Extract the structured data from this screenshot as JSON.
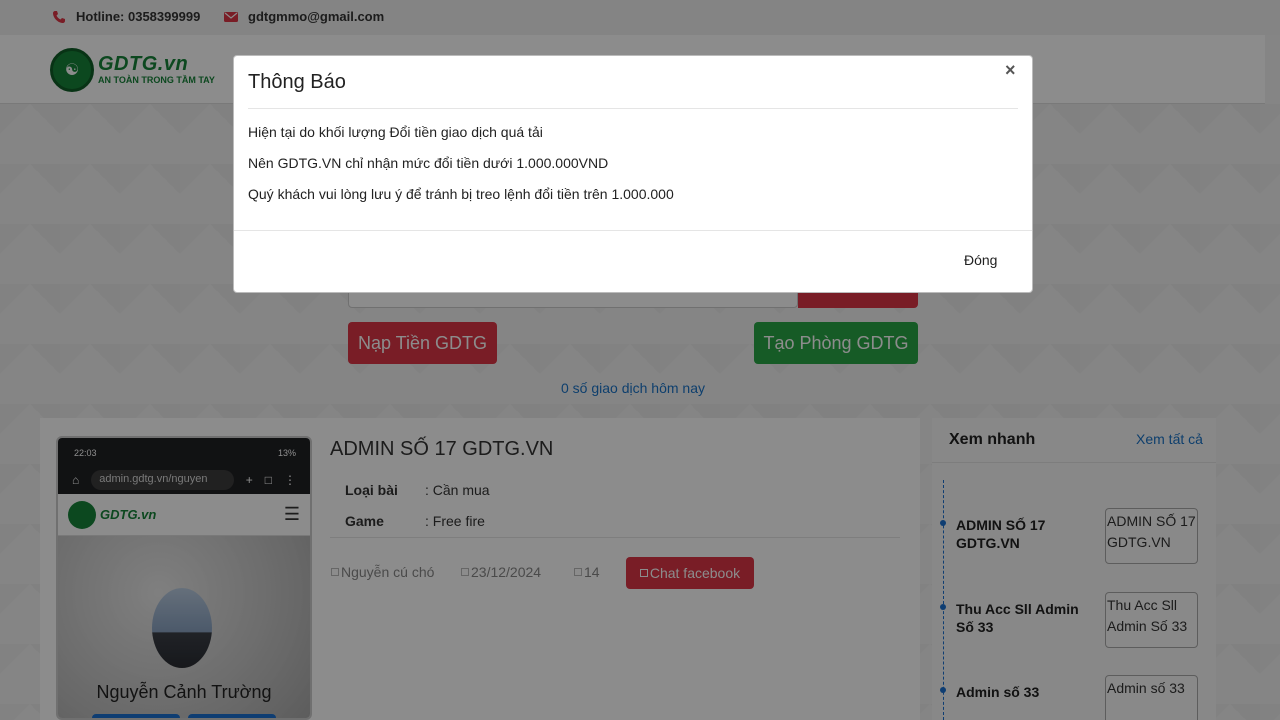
{
  "topbar": {
    "hotline": "Hotline: 0358399999",
    "email": "gdtgmmo@gmail.com"
  },
  "logo": {
    "brand": "GDTG.vn",
    "slogan": "AN TOÀN TRONG TẦM TAY"
  },
  "hero": {
    "deposit_button": "Nạp Tiền GDTG",
    "create_room_button": "Tạo Phòng GDTG",
    "today_count": "0 số giao dịch hôm nay"
  },
  "post": {
    "title": "ADMIN SỐ 17 GDTG.VN",
    "type_label": "Loại bài",
    "type_value": ":  Cần mua",
    "game_label": "Game",
    "game_value": ":  Free fire",
    "author": "Nguyễn cú chó",
    "date": "23/12/2024",
    "views": "14",
    "chat_button": "Chat facebook"
  },
  "phone_preview": {
    "time": "22:03",
    "battery": "13%",
    "url": "admin.gdtg.vn/nguyen",
    "brand": "GDTG.vn",
    "profile_name": "Nguyễn Cảnh Trường"
  },
  "sidebar": {
    "heading": "Xem nhanh",
    "view_all": "Xem tất cả",
    "items": [
      {
        "title": "ADMIN SỐ 17 GDTG.VN",
        "img_alt": "ADMIN SỐ 17 GDTG.VN"
      },
      {
        "title": "Thu Acc Sll Admin Số 33",
        "img_alt": "Thu Acc Sll Admin Số 33"
      },
      {
        "title": "Admin số 33",
        "img_alt": "Admin số 33"
      }
    ]
  },
  "modal": {
    "title": "Thông Báo",
    "close_symbol": "×",
    "lines": [
      "Hiện tại do khối lượng Đổi tiền giao dịch quá tải",
      "Nên GDTG.VN chỉ nhận mức đổi tiền dưới 1.000.000VND",
      "Quý khách vui lòng lưu ý để tránh bị treo lệnh đổi tiền trên 1.000.000"
    ],
    "close_button": "Đóng"
  },
  "colors": {
    "brand_green": "#17843a",
    "danger_red": "#dc3545",
    "success_green": "#28a745",
    "link_blue": "#1a73c7"
  }
}
